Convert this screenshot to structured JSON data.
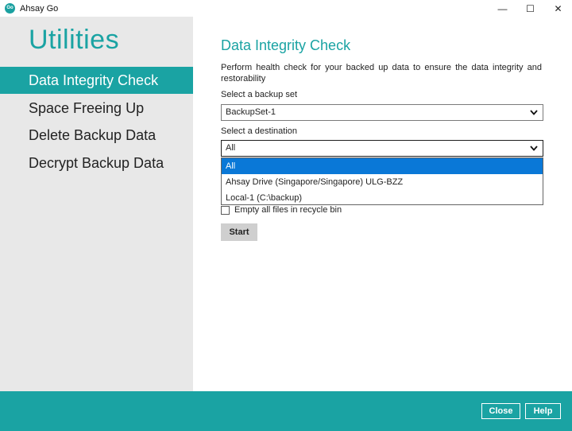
{
  "window": {
    "app_icon_text": "Go",
    "title": "Ahsay Go",
    "minimize_glyph": "—",
    "maximize_glyph": "☐",
    "close_glyph": "✕"
  },
  "sidebar": {
    "title": "Utilities",
    "items": [
      {
        "label": "Data Integrity Check",
        "active": true
      },
      {
        "label": "Space Freeing Up",
        "active": false
      },
      {
        "label": "Delete Backup Data",
        "active": false
      },
      {
        "label": "Decrypt Backup Data",
        "active": false
      }
    ]
  },
  "main": {
    "title": "Data Integrity Check",
    "description": "Perform health check for your backed up data to ensure the data integrity and restorability",
    "backup_set_label": "Select a backup set",
    "backup_set_value": "BackupSet-1",
    "destination_label": "Select a destination",
    "destination_value": "All",
    "destination_options": [
      {
        "label": "All",
        "selected": true
      },
      {
        "label": "Ahsay Drive (Singapore/Singapore) ULG-BZZ",
        "selected": false
      },
      {
        "label": "Local-1 (C:\\backup)",
        "selected": false
      }
    ],
    "recycle_bin_label": "Empty all files in recycle bin",
    "start_label": "Start"
  },
  "footer": {
    "close_label": "Close",
    "help_label": "Help"
  },
  "colors": {
    "accent": "#1aa3a3",
    "selection": "#0a78d7",
    "sidebar_bg": "#e8e8e8"
  }
}
